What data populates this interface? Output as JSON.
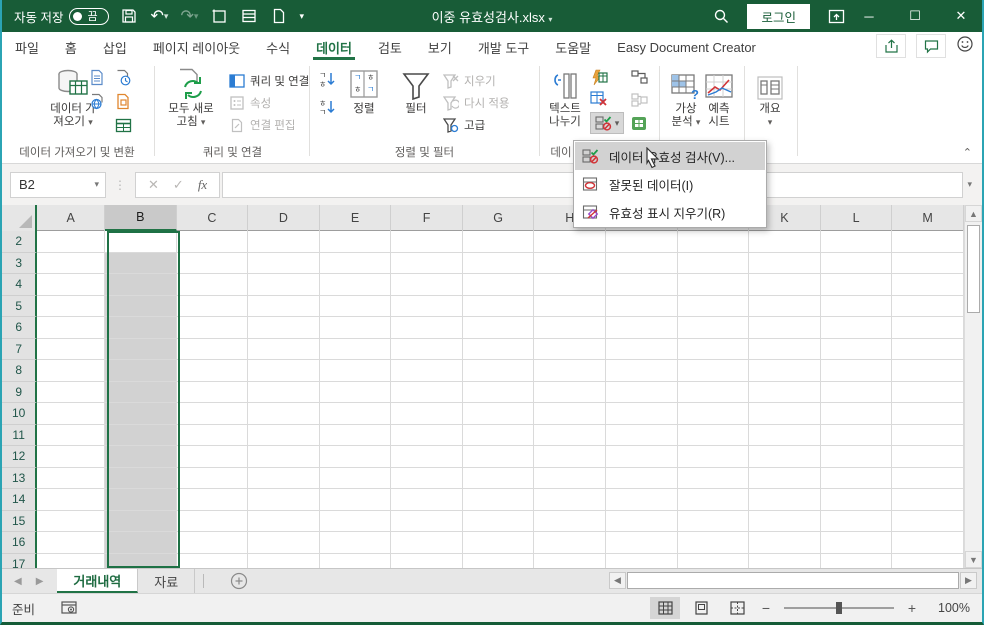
{
  "colors": {
    "title_green": "#185C37",
    "accent_green": "#217346",
    "selection_gray": "#D2D2D2",
    "window_border_teal": "#2BA4B4"
  },
  "title_bar": {
    "autosave_label": "자동 저장",
    "autosave_state": "끔",
    "doc_title": "이중 유효성검사.xlsx",
    "login_label": "로그인"
  },
  "ribbon": {
    "tabs": [
      {
        "label": "파일",
        "active": false
      },
      {
        "label": "홈",
        "active": false
      },
      {
        "label": "삽입",
        "active": false
      },
      {
        "label": "페이지 레이아웃",
        "active": false
      },
      {
        "label": "수식",
        "active": false
      },
      {
        "label": "데이터",
        "active": true
      },
      {
        "label": "검토",
        "active": false
      },
      {
        "label": "보기",
        "active": false
      },
      {
        "label": "개발 도구",
        "active": false
      },
      {
        "label": "도움말",
        "active": false
      },
      {
        "label": "Easy Document Creator",
        "active": false
      }
    ],
    "groups": {
      "get_data": {
        "button_line1": "데이터 가",
        "button_line2": "져오기",
        "label": "데이터 가져오기 및 변환"
      },
      "queries": {
        "button_line1": "모두 새로",
        "button_line2": "고침",
        "item_queries": "쿼리 및 연결",
        "item_props": "속성",
        "item_edit": "연결 편집",
        "label": "쿼리 및 연결"
      },
      "sort_filter": {
        "sort": "정렬",
        "filter": "필터",
        "clear": "지우기",
        "reapply": "다시 적용",
        "advanced": "고급",
        "label": "정렬 및 필터"
      },
      "data_tools": {
        "button_line1": "텍스트",
        "button_line2": "나누기",
        "label_partial": "데이"
      },
      "forecast": {
        "whatif_line1": "가상",
        "whatif_line2": "분석",
        "sheet_line1": "예측",
        "sheet_line2": "시트"
      },
      "outline": {
        "button": "개요"
      }
    }
  },
  "formula_bar": {
    "name_box": "B2",
    "fx": "fx",
    "cancel": "✕",
    "enter": "✓"
  },
  "validation_menu": {
    "items": [
      {
        "label": "데이터 유효성 검사(V)...",
        "icon": "data-validation-icon",
        "highlighted": true
      },
      {
        "label": "잘못된 데이터(I)",
        "icon": "circle-invalid-data-icon",
        "highlighted": false
      },
      {
        "label": "유효성 표시 지우기(R)",
        "icon": "clear-validation-circles-icon",
        "highlighted": false
      }
    ]
  },
  "grid": {
    "columns": [
      "A",
      "B",
      "C",
      "D",
      "E",
      "F",
      "G",
      "H",
      "I",
      "J",
      "K",
      "L",
      "M"
    ],
    "selected_column": "B",
    "active_cell": "B2",
    "rows": [
      2,
      3,
      4,
      5,
      6,
      7,
      8,
      9,
      10,
      11,
      12,
      13,
      14,
      15,
      16,
      17
    ]
  },
  "sheet_bar": {
    "tabs": [
      {
        "label": "거래내역",
        "active": true
      },
      {
        "label": "자료",
        "active": false
      }
    ]
  },
  "status_bar": {
    "ready": "준비",
    "zoom": "100%",
    "zoom_minus": "−",
    "zoom_plus": "+"
  }
}
